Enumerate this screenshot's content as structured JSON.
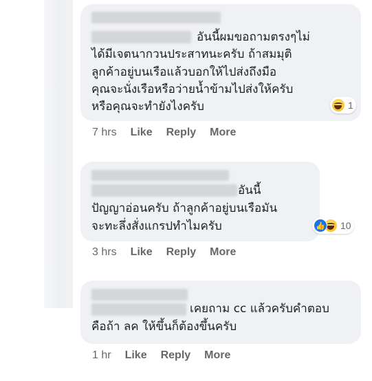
{
  "comments": [
    {
      "text_lines": [
        "อันนี้ผมขอถามตรงๆไม่",
        "ได้มีเจตนากวนประสาทนะครับ ถ้าสมมุติ",
        "ลูกค้าอยู่บนเรือแล้วบอกให้ไปส่งถึงมือ",
        "คุณจะนั่งเรือหรือว่ายน้ำข้ามไปส่งให้ครับ",
        "หรือคุณจะทำยังไงครับ"
      ],
      "reaction": {
        "icons": [
          "haha-emoji"
        ],
        "count": "1"
      },
      "time": "7 hrs",
      "like_label": "Like",
      "reply_label": "Reply",
      "more_label": "More"
    },
    {
      "text_lines": [
        "อันนี้",
        "ปัญญาอ่อนครับ ถ้าลูกค้าอยู่บนเรือมัน",
        "จะทะลึ่งสั่งแกรปทำไมครับ"
      ],
      "reaction": {
        "icons": [
          "like-emoji",
          "haha-emoji"
        ],
        "count": "10"
      },
      "time": "3 hrs",
      "like_label": "Like",
      "reply_label": "Reply",
      "more_label": "More"
    },
    {
      "text_lines": [
        "เคยถาม cc แล้วครับคำตอบ",
        "คือถ้า ลค ให้ขึ้นก็ต้องขึ้นครับ"
      ],
      "time": "1 hr",
      "like_label": "Like",
      "reply_label": "Reply",
      "more_label": "More"
    }
  ],
  "colors": {
    "bubble": "#eff1f4",
    "text": "#1c1e21",
    "meta": "#65676b",
    "like_blue": "#1b74e4"
  }
}
